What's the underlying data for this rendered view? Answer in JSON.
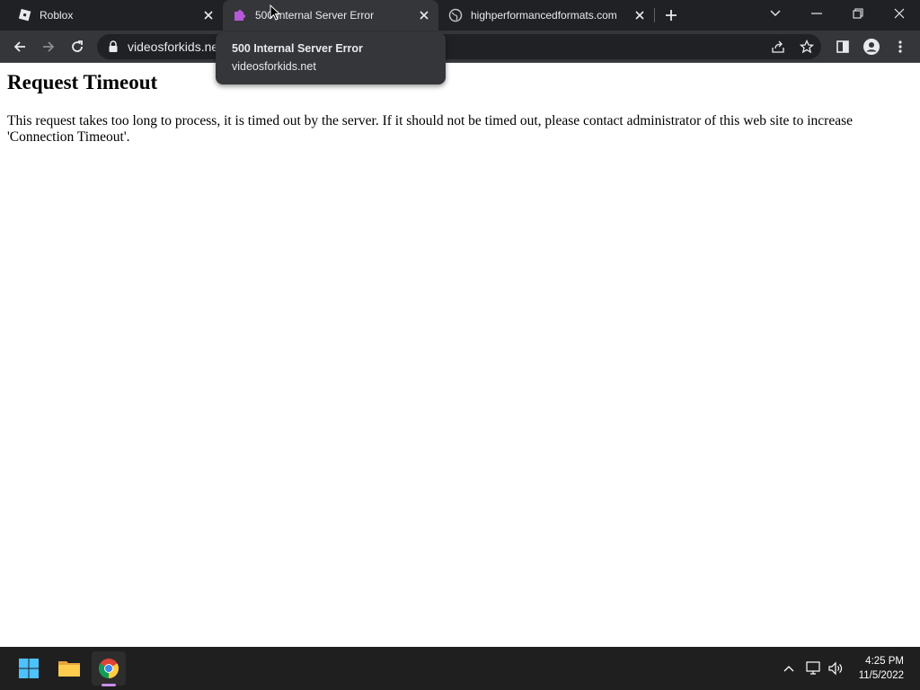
{
  "browser": {
    "tabs": [
      {
        "title": "Roblox",
        "favicon": "roblox-icon",
        "active": false
      },
      {
        "title": "500 Internal Server Error",
        "favicon": "puzzle-icon",
        "active": true
      },
      {
        "title": "highperformancedformats.com",
        "favicon": "globe-icon",
        "active": false
      }
    ],
    "address_bar": {
      "url": "videosforkids.net"
    },
    "tooltip": {
      "title": "500 Internal Server Error",
      "domain": "videosforkids.net"
    }
  },
  "page": {
    "heading": "Request Timeout",
    "body": "This request takes too long to process, it is timed out by the server. If it should not be timed out, please contact administrator of this web site to increase 'Connection Timeout'."
  },
  "taskbar": {
    "apps": [
      "start-icon",
      "file-explorer-icon",
      "chrome-icon"
    ],
    "clock": {
      "time": "4:25 PM",
      "date": "11/5/2022"
    }
  },
  "colors": {
    "tabstrip": "#202124",
    "toolbar": "#35363a",
    "omnibox": "#202124",
    "taskbar": "#1f1f1f",
    "active_indicator": "#c98ee8"
  }
}
